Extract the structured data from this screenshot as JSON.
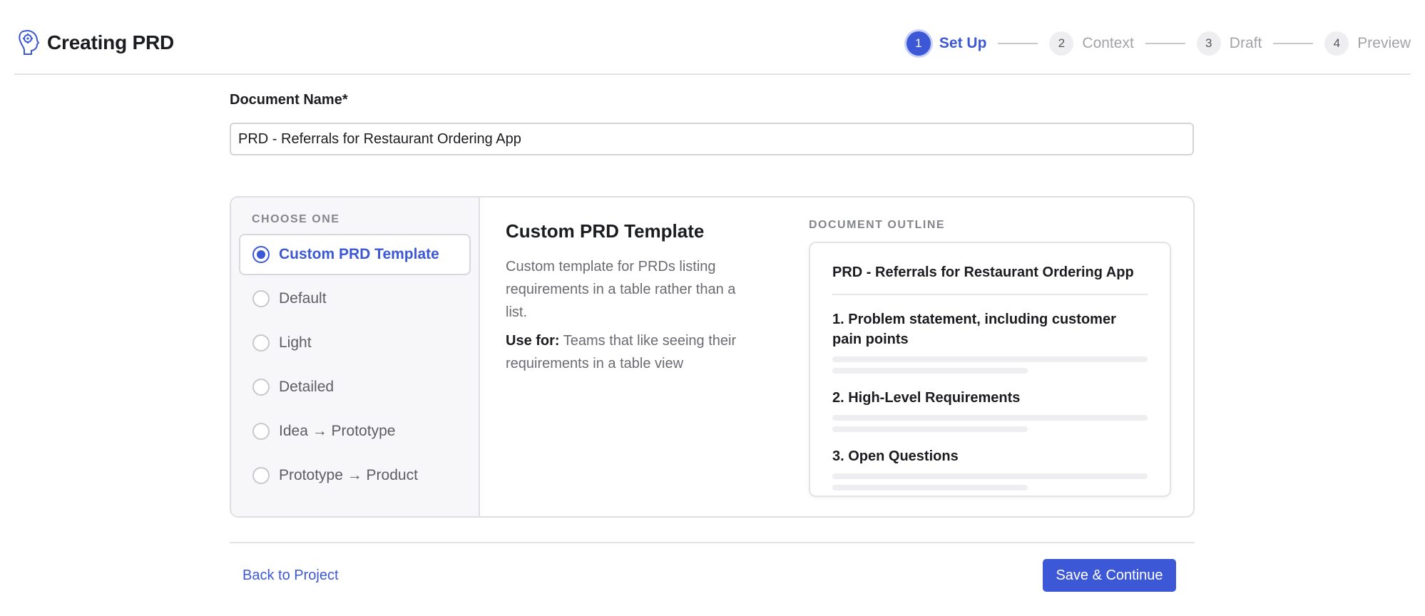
{
  "header": {
    "title": "Creating PRD",
    "logo_icon": "brain-gear-icon",
    "steps": [
      {
        "number": "1",
        "label": "Set Up",
        "active": true
      },
      {
        "number": "2",
        "label": "Context",
        "active": false
      },
      {
        "number": "3",
        "label": "Draft",
        "active": false
      },
      {
        "number": "4",
        "label": "Preview",
        "active": false
      }
    ]
  },
  "document": {
    "label": "Document Name*",
    "value": "PRD - Referrals for Restaurant Ordering App"
  },
  "templates": {
    "heading": "CHOOSE ONE",
    "selected": "Custom PRD Template",
    "options": [
      "Custom PRD Template",
      "Default",
      "Light",
      "Detailed",
      "Idea → Prototype",
      "Prototype → Product"
    ]
  },
  "detail": {
    "title": "Custom PRD Template",
    "description": "Custom template for PRDs listing requirements in a table rather than a list.",
    "use_for_label": "Use for:",
    "use_for_text": " Teams that like seeing their requirements in a table view"
  },
  "outline": {
    "heading": "DOCUMENT OUTLINE",
    "doc_title": "PRD - Referrals for Restaurant Ordering App",
    "sections": [
      "1. Problem statement, including customer pain points",
      "2. High-Level Requirements",
      "3. Open Questions"
    ]
  },
  "footer": {
    "back_label": "Back to Project",
    "save_label": "Save & Continue"
  },
  "colors": {
    "accent": "#3d58d6",
    "muted_text": "#6b6c72",
    "border": "#dedfe2"
  }
}
